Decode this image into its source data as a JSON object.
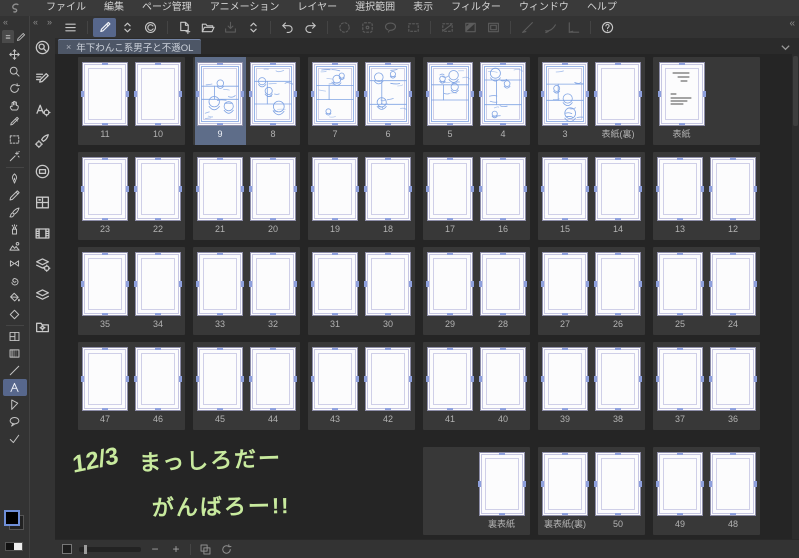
{
  "menu_bar": {
    "items": [
      "ファイル",
      "編集",
      "ページ管理",
      "アニメーション",
      "レイヤー",
      "選択範囲",
      "表示",
      "フィルター",
      "ウィンドウ",
      "ヘルプ"
    ]
  },
  "toolbar": {
    "groups": [
      [
        {
          "name": "hamburger"
        }
      ],
      [
        {
          "name": "edit-page",
          "state": "active"
        },
        {
          "name": "updown-chevrons"
        },
        {
          "name": "clip-studio"
        }
      ],
      [
        {
          "name": "new-page"
        },
        {
          "name": "open-folder"
        },
        {
          "name": "save",
          "state": "disabled"
        },
        {
          "name": "updown-chevrons"
        }
      ],
      [
        {
          "name": "undo"
        },
        {
          "name": "redo"
        }
      ],
      [
        {
          "name": "select-launcher",
          "state": "disabled"
        },
        {
          "name": "select-more",
          "state": "disabled"
        },
        {
          "name": "lasso",
          "state": "disabled"
        },
        {
          "name": "select-rect",
          "state": "disabled"
        }
      ],
      [
        {
          "name": "deselect",
          "state": "disabled"
        },
        {
          "name": "invert-selection",
          "state": "disabled"
        },
        {
          "name": "select-border",
          "state": "disabled"
        }
      ],
      [
        {
          "name": "snap-ruler",
          "state": "disabled"
        },
        {
          "name": "snap-special",
          "state": "disabled"
        },
        {
          "name": "snap-grid",
          "state": "disabled"
        }
      ],
      [
        {
          "name": "help"
        }
      ]
    ],
    "collapse_glyph": "«"
  },
  "tab_bar": {
    "tab": {
      "close_glyph": "×",
      "title": "年下わんこ系男子と不遜OL"
    },
    "overflow_icon": "chevron-down"
  },
  "tool_dock": {
    "header_left_glyph": "«",
    "header_right_glyph": "»",
    "tab_icons": [
      "hamburger",
      "pencil"
    ],
    "tools": [
      {
        "name": "move"
      },
      {
        "name": "zoom"
      },
      {
        "name": "rotate"
      },
      {
        "name": "hand"
      },
      {
        "name": "eyedropper"
      },
      {
        "name": "marquee"
      },
      {
        "name": "wand"
      },
      {
        "sep": true
      },
      {
        "name": "pen"
      },
      {
        "name": "pencil"
      },
      {
        "name": "brush"
      },
      {
        "name": "airbrush"
      },
      {
        "name": "decoration"
      },
      {
        "name": "ribbon"
      },
      {
        "name": "blend"
      },
      {
        "name": "bucket"
      },
      {
        "name": "eraser"
      },
      {
        "sep": true
      },
      {
        "name": "frame"
      },
      {
        "name": "gradient"
      },
      {
        "name": "line"
      },
      {
        "name": "text",
        "state": "active"
      },
      {
        "name": "flow"
      },
      {
        "name": "balloon"
      },
      {
        "name": "correct"
      }
    ],
    "palette_icons": [
      "quick-access",
      "subtool",
      "tool-property",
      "brush-detail",
      "navigator",
      "page-manager",
      "timeline",
      "layer-property",
      "layer",
      "material"
    ],
    "foreground_color": "#000000",
    "background_color": "#222222"
  },
  "page_grid": {
    "rows": [
      {
        "cells": [
          {
            "pages": [
              {
                "label": "11",
                "content": "blank"
              },
              {
                "label": "10",
                "content": "blank"
              }
            ]
          },
          {
            "pages": [
              {
                "label": "9",
                "content": "sketch",
                "selected": true
              },
              {
                "label": "8",
                "content": "sketch"
              }
            ]
          },
          {
            "pages": [
              {
                "label": "7",
                "content": "sketch"
              },
              {
                "label": "6",
                "content": "sketch"
              }
            ]
          },
          {
            "pages": [
              {
                "label": "5",
                "content": "sketch"
              },
              {
                "label": "4",
                "content": "sketch"
              }
            ]
          },
          {
            "pages": [
              {
                "label": "3",
                "content": "sketch"
              },
              {
                "label": "表紙(裏)",
                "content": "blank"
              }
            ]
          },
          {
            "pages": [
              {
                "label": "表紙",
                "content": "title"
              }
            ],
            "align": "left"
          }
        ]
      },
      {
        "cells": [
          {
            "pages": [
              {
                "label": "23",
                "content": "blank"
              },
              {
                "label": "22",
                "content": "blank"
              }
            ]
          },
          {
            "pages": [
              {
                "label": "21",
                "content": "blank"
              },
              {
                "label": "20",
                "content": "blank"
              }
            ]
          },
          {
            "pages": [
              {
                "label": "19",
                "content": "blank"
              },
              {
                "label": "18",
                "content": "blank"
              }
            ]
          },
          {
            "pages": [
              {
                "label": "17",
                "content": "blank"
              },
              {
                "label": "16",
                "content": "blank"
              }
            ]
          },
          {
            "pages": [
              {
                "label": "15",
                "content": "blank"
              },
              {
                "label": "14",
                "content": "blank"
              }
            ]
          },
          {
            "pages": [
              {
                "label": "13",
                "content": "blank"
              },
              {
                "label": "12",
                "content": "blank"
              }
            ]
          }
        ]
      },
      {
        "cells": [
          {
            "pages": [
              {
                "label": "35",
                "content": "blank"
              },
              {
                "label": "34",
                "content": "blank"
              }
            ]
          },
          {
            "pages": [
              {
                "label": "33",
                "content": "blank"
              },
              {
                "label": "32",
                "content": "blank"
              }
            ]
          },
          {
            "pages": [
              {
                "label": "31",
                "content": "blank"
              },
              {
                "label": "30",
                "content": "blank"
              }
            ]
          },
          {
            "pages": [
              {
                "label": "29",
                "content": "blank"
              },
              {
                "label": "28",
                "content": "blank"
              }
            ]
          },
          {
            "pages": [
              {
                "label": "27",
                "content": "blank"
              },
              {
                "label": "26",
                "content": "blank"
              }
            ]
          },
          {
            "pages": [
              {
                "label": "25",
                "content": "blank"
              },
              {
                "label": "24",
                "content": "blank"
              }
            ]
          }
        ]
      },
      {
        "cells": [
          {
            "pages": [
              {
                "label": "47",
                "content": "blank"
              },
              {
                "label": "46",
                "content": "blank"
              }
            ]
          },
          {
            "pages": [
              {
                "label": "45",
                "content": "blank"
              },
              {
                "label": "44",
                "content": "blank"
              }
            ]
          },
          {
            "pages": [
              {
                "label": "43",
                "content": "blank"
              },
              {
                "label": "42",
                "content": "blank"
              }
            ]
          },
          {
            "pages": [
              {
                "label": "41",
                "content": "blank"
              },
              {
                "label": "40",
                "content": "blank"
              }
            ]
          },
          {
            "pages": [
              {
                "label": "39",
                "content": "blank"
              },
              {
                "label": "38",
                "content": "blank"
              }
            ]
          },
          {
            "pages": [
              {
                "label": "37",
                "content": "blank"
              },
              {
                "label": "36",
                "content": "blank"
              }
            ]
          }
        ]
      },
      {
        "gap_before": true,
        "cells": [
          null,
          null,
          null,
          {
            "pages": [
              {
                "label": "裏表紙",
                "content": "blank"
              }
            ],
            "align": "right"
          },
          {
            "pages": [
              {
                "label": "裏表紙(裏)",
                "content": "blank"
              },
              {
                "label": "50",
                "content": "blank"
              }
            ]
          },
          {
            "pages": [
              {
                "label": "49",
                "content": "blank"
              },
              {
                "label": "48",
                "content": "blank"
              }
            ]
          }
        ]
      }
    ]
  },
  "annotation": {
    "date": "12/3",
    "line1": "まっしろだー",
    "line2": "がんばろー!!",
    "color": "#c8ea9e"
  },
  "status_bar": {
    "zoom_out_label": "−",
    "zoom_in_label": "+",
    "icons": [
      "actual-size",
      "reset-view"
    ],
    "slider_position_pct": 8
  },
  "colors": {
    "selection_highlight": "#5e6d89",
    "active_button": "#57678c",
    "sketch_blue": "#7fa3e3",
    "panel_background": "#383838",
    "canvas_background": "#252525",
    "tab_background": "#4d5666"
  }
}
